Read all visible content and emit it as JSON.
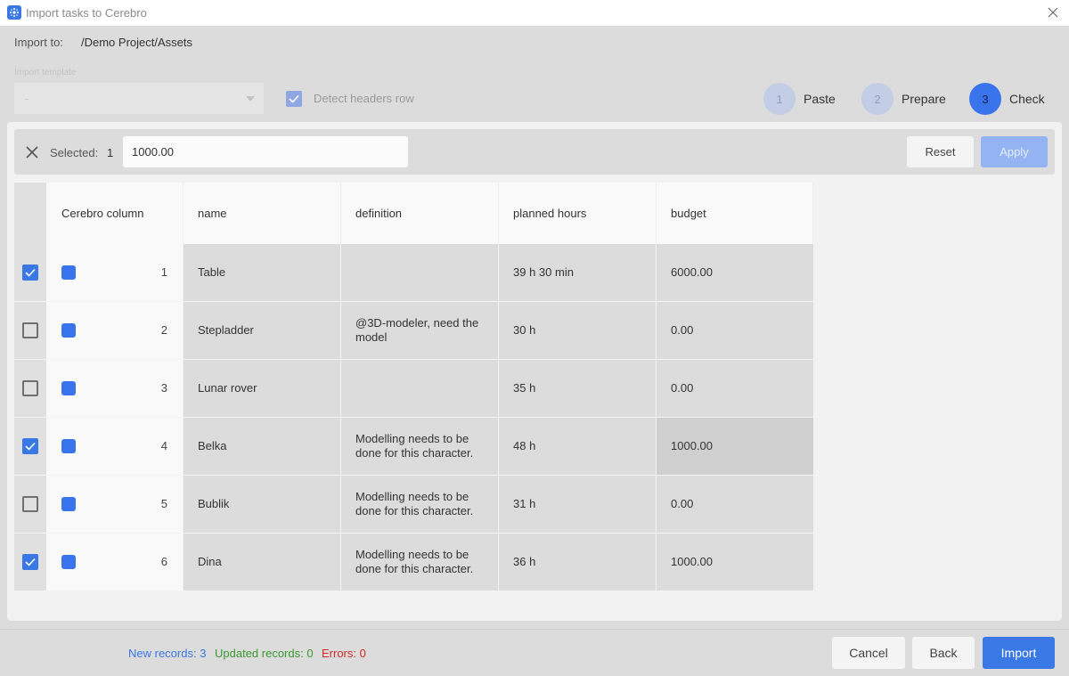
{
  "window": {
    "title": "Import tasks to Cerebro"
  },
  "import_to": {
    "label": "Import to:",
    "path": "/Demo Project/Assets"
  },
  "template": {
    "label": "Import template",
    "value": "-"
  },
  "detect_headers": {
    "label": "Detect headers row",
    "checked": true
  },
  "steps": [
    {
      "number": "1",
      "label": "Paste",
      "active": false
    },
    {
      "number": "2",
      "label": "Prepare",
      "active": false
    },
    {
      "number": "3",
      "label": "Check",
      "active": true
    }
  ],
  "selection": {
    "label": "Selected:",
    "count": "1",
    "value": "1000.00",
    "reset_label": "Reset",
    "apply_label": "Apply"
  },
  "table": {
    "headers": [
      "Cerebro column",
      "name",
      "definition",
      "planned hours",
      "budget"
    ],
    "rows": [
      {
        "checked": true,
        "index": "1",
        "name": "Table",
        "definition": "",
        "hours": "39 h 30 min",
        "budget": "6000.00"
      },
      {
        "checked": false,
        "index": "2",
        "name": "Stepladder",
        "definition": "@3D-modeler, need the model",
        "hours": "30 h",
        "budget": "0.00"
      },
      {
        "checked": false,
        "index": "3",
        "name": "Lunar rover",
        "definition": "",
        "hours": "35 h",
        "budget": "0.00"
      },
      {
        "checked": true,
        "index": "4",
        "name": "Belka",
        "definition": "Modelling needs to be done for this character.",
        "hours": "48 h",
        "budget": "1000.00",
        "budget_highlight": true
      },
      {
        "checked": false,
        "index": "5",
        "name": "Bublik",
        "definition": "Modelling needs to be done for this character.",
        "hours": "31 h",
        "budget": "0.00"
      },
      {
        "checked": true,
        "index": "6",
        "name": "Dina",
        "definition": "Modelling needs to be done for this character.",
        "hours": "36 h",
        "budget": "1000.00"
      }
    ]
  },
  "stats": {
    "new": "New records: 3",
    "updated": "Updated records: 0",
    "errors": "Errors: 0"
  },
  "buttons": {
    "cancel": "Cancel",
    "back": "Back",
    "import": "Import"
  },
  "colors": {
    "accent": "#3a78e6",
    "new": "#3a78e6",
    "updated": "#3a9a32",
    "errors": "#d62a2a"
  },
  "icons": {
    "app": "cerebro-app-icon",
    "close": "close-icon",
    "clear": "clear-selection-icon",
    "dropdown": "chevron-down-icon",
    "check": "check-icon"
  }
}
